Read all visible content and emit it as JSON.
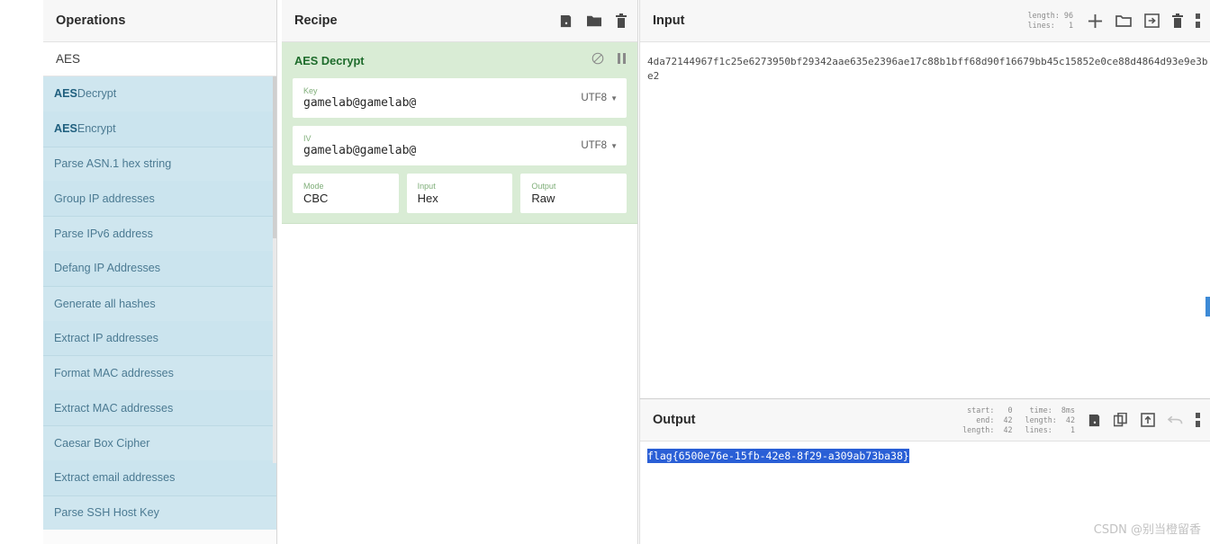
{
  "operations": {
    "header_title": "Operations",
    "category": "AES",
    "items": [
      {
        "pre": "AES",
        "post": " Decrypt",
        "full": "AES Decrypt"
      },
      {
        "pre": "AES",
        "post": " Encrypt",
        "full": "AES Encrypt"
      },
      {
        "pre": "",
        "post": "Parse ASN.1 hex string",
        "full": "Parse ASN.1 hex string"
      },
      {
        "pre": "",
        "post": "Group IP addresses",
        "full": "Group IP addresses"
      },
      {
        "pre": "",
        "post": "Parse IPv6 address",
        "full": "Parse IPv6 address"
      },
      {
        "pre": "",
        "post": "Defang IP Addresses",
        "full": "Defang IP Addresses"
      },
      {
        "pre": "",
        "post": "Generate all hashes",
        "full": "Generate all hashes"
      },
      {
        "pre": "",
        "post": "Extract IP addresses",
        "full": "Extract IP addresses"
      },
      {
        "pre": "",
        "post": "Format MAC addresses",
        "full": "Format MAC addresses"
      },
      {
        "pre": "",
        "post": "Extract MAC addresses",
        "full": "Extract MAC addresses"
      },
      {
        "pre": "",
        "post": "Caesar Box Cipher",
        "full": "Caesar Box Cipher"
      },
      {
        "pre": "",
        "post": "Extract email addresses",
        "full": "Extract email addresses"
      },
      {
        "pre": "",
        "post": "Parse SSH Host Key",
        "full": "Parse SSH Host Key"
      }
    ]
  },
  "recipe": {
    "header_title": "Recipe",
    "icons": [
      "save-icon",
      "folder-icon",
      "trash-icon"
    ],
    "operation": {
      "name": "AES Decrypt",
      "controls": [
        "disable-icon",
        "pause-icon"
      ],
      "args": {
        "key_label": "Key",
        "key_value": "gamelab@gamelab@",
        "key_encoding": "UTF8",
        "iv_label": "IV",
        "iv_value": "gamelab@gamelab@",
        "iv_encoding": "UTF8",
        "mode_label": "Mode",
        "mode_value": "CBC",
        "input_label": "Input",
        "input_value": "Hex",
        "output_label": "Output",
        "output_value": "Raw"
      }
    }
  },
  "input": {
    "header_title": "Input",
    "stats": "length: 96\nlines:   1",
    "value": "4da72144967f1c25e6273950bf29342aae635e2396ae17c88b1bff68d90f16679bb45c15852e0ce88d4864d93e9e3be2",
    "icons": [
      "plus-icon",
      "folder-icon",
      "import-icon",
      "trash-icon",
      "columns-icon"
    ]
  },
  "output": {
    "header_title": "Output",
    "stats_left": "start:   0\n  end:  42\nlength:  42",
    "stats_right": "time:  8ms\nlength:  42\nlines:    1",
    "value": "flag{6500e76e-15fb-42e8-8f29-a309ab73ba38}",
    "icons": [
      "save-icon",
      "copy-icon",
      "bake-to-input-icon",
      "undo-icon",
      "maximise-icon"
    ]
  },
  "watermark": "CSDN @别当橙留香",
  "colors": {
    "recipe_op_bg": "#d9ecd5",
    "recipe_op_title": "#1d6b2b",
    "ops_list_bg": "#cfe6ef",
    "ops_item_text": "#4b7a92",
    "selection": "#2a5fd6",
    "panel_header_bg": "#f7f7f7"
  }
}
